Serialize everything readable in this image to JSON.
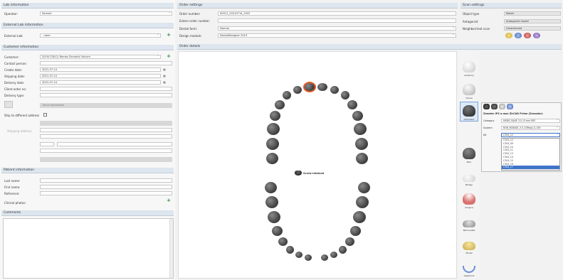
{
  "lab_info": {
    "title": "Lab information",
    "operator_label": "Operator:",
    "operator_value": "Samuel",
    "ext_title": "External Lab information",
    "ext_label": "External Lab:",
    "ext_value": "- none -"
  },
  "customer": {
    "title": "Customer information",
    "customer_label": "Customer:",
    "customer_value": "2019/7/30(1) Romas Zervakis Ostrum",
    "contact_label": "Contact person:",
    "create_label": "Create date:",
    "create_value": "2021-07-14",
    "shipping_label": "Shipping date:",
    "shipping_value": "2021-07-14",
    "delivery_label": "Delivery date:",
    "delivery_value": "2021-07-14",
    "client_order_label": "Client order no:",
    "delivery_type_label": "Delivery type:",
    "send_info": "Send information",
    "ship_diff_label": "Ship to different address",
    "shipping_addr_label": "Shipping address"
  },
  "patient": {
    "title": "Patient information",
    "last_label": "Last name:",
    "first_label": "First name:",
    "ref_label": "Reference:",
    "photos_label": "Clinical photos:"
  },
  "comments": {
    "title": "Comments"
  },
  "order": {
    "title": "Order settings",
    "number_label": "Order number:",
    "number_value": "00011_20210714_1022",
    "extern_label": "Extern order number:",
    "dentist_label": "Dental form:",
    "dentist_value": "Normal",
    "module_label": "Design module:",
    "module_value": "DentalDesigner 2019",
    "details_title": "Order details",
    "tooth_label": "Screw-retained"
  },
  "scan": {
    "title": "Scan settings",
    "object_label": "Object type",
    "object_value": "Model",
    "antag_label": "Antagonist",
    "antag_value": "Antagonist model",
    "neighbor_label": "Neighbor/root scan",
    "neighbor_value": "Unsectioned"
  },
  "tools": [
    {
      "label": "Anatomy"
    },
    {
      "label": "Frame"
    },
    {
      "label": "Abutment"
    },
    {
      "label": "Misc"
    },
    {
      "label": "Bridge"
    },
    {
      "label": "Gingiva"
    },
    {
      "label": "Removable"
    },
    {
      "label": "Model"
    },
    {
      "label": "Appliance"
    }
  ],
  "popup": {
    "title": "Zenotec IPS e.max ZirCAD Prime (Zenostar)",
    "category_label": "Category",
    "category_value": "MEDIC BASE 3.5-13 mm REF",
    "system_label": "System",
    "system_value": "NOB_BCBASE_3.5_S3Rept_G-138",
    "kit_label": "Kit",
    "kit_value": "C304_12",
    "list": [
      "C304_12",
      "C304_09",
      "C304_10",
      "C304_11",
      "C304_13",
      "C304_14",
      "C304_15",
      "C304_16",
      "C304_17"
    ],
    "selected_index": 8
  },
  "colors": {
    "accent": "#2a8c3e",
    "header_bg": "#dde5ee",
    "selected": "#3d74c9"
  }
}
